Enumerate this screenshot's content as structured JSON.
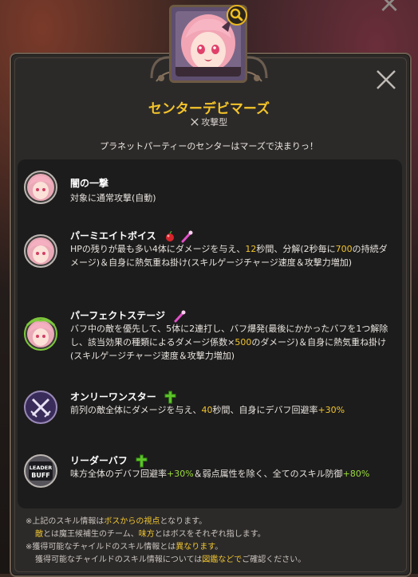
{
  "window": {
    "close_glyph": "×"
  },
  "character": {
    "name": "センターデビマーズ",
    "type_icon": "crossed-swords",
    "type": "攻撃型",
    "description": "プラネットパーティーのセンターはマーズで決まりっ！"
  },
  "skills": [
    {
      "name": "闇の一撃",
      "icon": "character-portrait",
      "text_parts": [
        "対象に通常攻撃(自動)"
      ]
    },
    {
      "name": "パーミエイトボイス",
      "icon": "character-portrait",
      "badges": [
        "red-orb",
        "pink-wand"
      ],
      "text_parts": [
        "HPの残りが最も多い4体にダメージを与え、",
        "12",
        "秒間、分解(2秒毎に",
        "700",
        "の持続ダメージ)＆自身に熱気重ね掛け(スキルゲージチャージ速度＆攻撃力増加)"
      ]
    },
    {
      "name": "パーフェクトステージ",
      "icon": "character-portrait-wreath",
      "badges": [
        "pink-wand"
      ],
      "text_parts": [
        "バフ中の敵を優先して、5体に2連打し、バフ爆発(最後にかかったバフを1つ解除し、該当効果の種類によるダメージ係数×",
        "500",
        "のダメージ)＆自身に熱気重ね掛け(スキルゲージチャージ速度＆攻撃力増加)"
      ]
    },
    {
      "name": "オンリーワンスター",
      "icon": "crossed-swords-icon",
      "badges": [
        "green-cross"
      ],
      "text_parts": [
        "前列の敵全体にダメージを与え、",
        "40",
        "秒間、自身にデバフ回避率",
        "+30%"
      ]
    },
    {
      "name": "リーダーバフ",
      "icon": "leader-buff",
      "icon_text": [
        "LEADER",
        "BUFF"
      ],
      "badges": [
        "green-cross"
      ],
      "text_parts": [
        "味方全体のデバフ回避率",
        "+30%",
        "＆弱点属性を除く、全てのスキル防御",
        "+80%"
      ]
    }
  ],
  "notes": {
    "l1": [
      "※上記のスキル情報は",
      "ボスからの視点",
      "となります。"
    ],
    "l2": [
      "敵",
      "とは魔王候補生のチーム、",
      "味方",
      "とはボスをそれぞれ指します。"
    ],
    "l3": [
      "※獲得可能なチャイルドのスキル情報とは",
      "異なります",
      "。"
    ],
    "l4": [
      "獲得可能なチャイルドのスキル情報については",
      "図鑑などで",
      "ご確認ください。"
    ]
  },
  "colors": {
    "accent": "#f4c42a",
    "highlight": "#f0c530",
    "green": "#9bdc3c"
  }
}
